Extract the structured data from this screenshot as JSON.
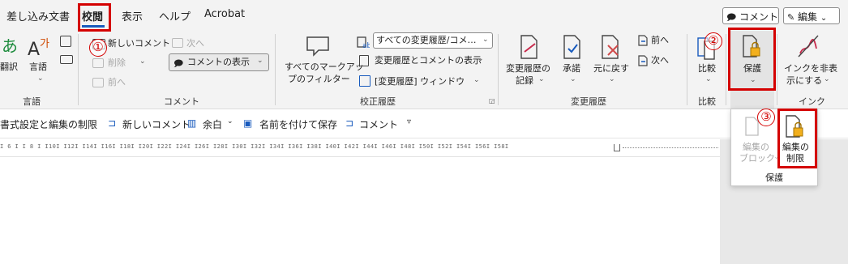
{
  "tabs": {
    "mailings": "差し込み文書",
    "review": "校閲",
    "view": "表示",
    "help": "ヘルプ",
    "acrobat": "Acrobat"
  },
  "top_right": {
    "comments_label": "コメント",
    "editing_label": "編集",
    "chevron": "⌄"
  },
  "ribbon": {
    "translate_label": "翻訳",
    "language_label": "言語",
    "group_language": "言語",
    "new_comment_label": "新しいコメント",
    "delete_label": "削除",
    "previous_label": "前へ",
    "next_label": "次へ",
    "show_comments_label": "コメントの表示",
    "group_comments": "コメント",
    "all_markup_filter_line1": "すべてのマークアッ",
    "all_markup_filter_line2": "プのフィルター",
    "markup_combo_value": "すべての変更履歴/コメ…",
    "show_markup_label": "変更履歴とコメントの表示",
    "reviewing_pane_label": "[変更履歴] ウィンドウ",
    "group_tracking": "校正履歴",
    "track_changes_line1": "変更履歴の",
    "track_changes_line2": "記録",
    "accept_label": "承諾",
    "reject_label": "元に戻す",
    "change_prev_label": "前へ",
    "change_next_label": "次へ",
    "group_changes": "変更履歴",
    "compare_label": "比較",
    "group_compare": "比較",
    "protect_label": "保護",
    "hide_ink_line1": "インクを非表",
    "hide_ink_line2": "示にする",
    "group_ink": "インク"
  },
  "protect_popup": {
    "block_authors_line1": "編集の",
    "block_authors_line2": "ブロック",
    "restrict_editing_line1": "編集の",
    "restrict_editing_line2": "制限",
    "group_label": "保護"
  },
  "qat": {
    "restrict_formatting": "書式設定と編集の制限",
    "new_comment": "新しいコメント",
    "margins": "余白",
    "save_as": "名前を付けて保存",
    "comment": "コメント",
    "more": "▿"
  },
  "ruler": {
    "ticks": "I 6 I  I 8 I  I10I  I12I  I14I  I16I  I18I  I20I  I22I  I24I  I26I  I28I  I30I  I32I  I34I  I36I  I38I  I40I  I42I  I44I  I46I  I48I  I50I  I52I  I54I  I56I  I58I"
  },
  "annotations": {
    "step1": "①",
    "step2": "②",
    "step3": "③"
  },
  "colors": {
    "accent_blue": "#185abd",
    "annotation_red": "#d40000",
    "ribbon_bg": "#f3f3f3"
  }
}
